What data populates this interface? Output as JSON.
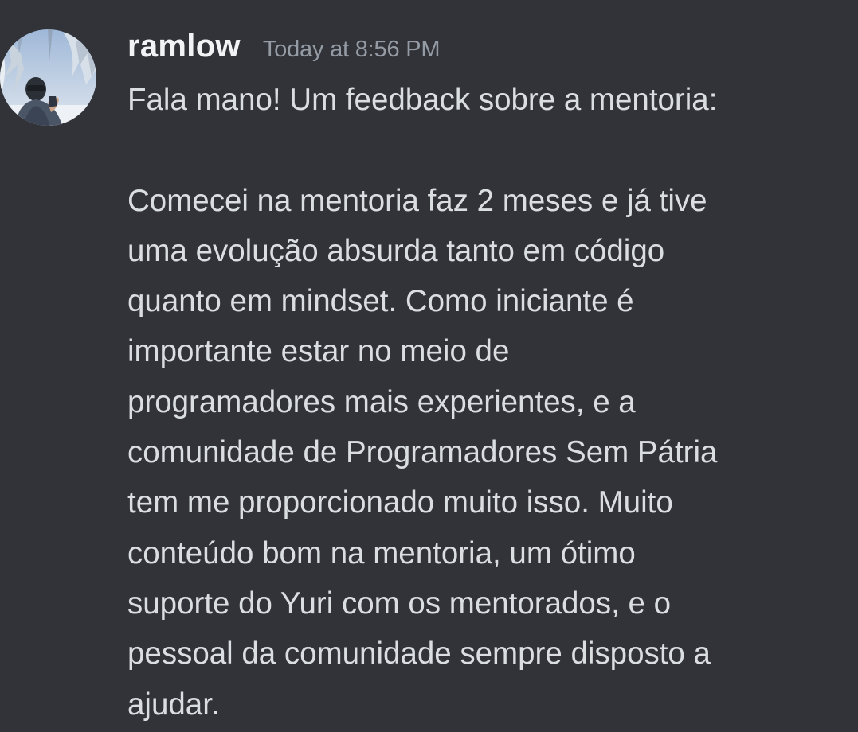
{
  "message": {
    "author": "ramlow",
    "timestamp": "Today at 8:56 PM",
    "intro": "Fala mano! Um feedback sobre a mentoria:",
    "body_lines": [
      "Comecei na mentoria faz 2 meses e já tive",
      "uma evolução absurda tanto em código",
      "quanto em mindset. Como iniciante é",
      "importante estar no meio de",
      "programadores mais experientes, e a",
      "comunidade de Programadores Sem Pátria",
      "tem me proporcionado muito isso. Muito",
      "conteúdo bom na mentoria, um ótimo",
      "suporte do Yuri com os mentorados, e o",
      "pessoal da comunidade sempre disposto a",
      "ajudar."
    ]
  },
  "colors": {
    "background": "#313338",
    "username": "#f2f3f5",
    "timestamp": "#949ba4",
    "message_text": "#dbdee1"
  }
}
